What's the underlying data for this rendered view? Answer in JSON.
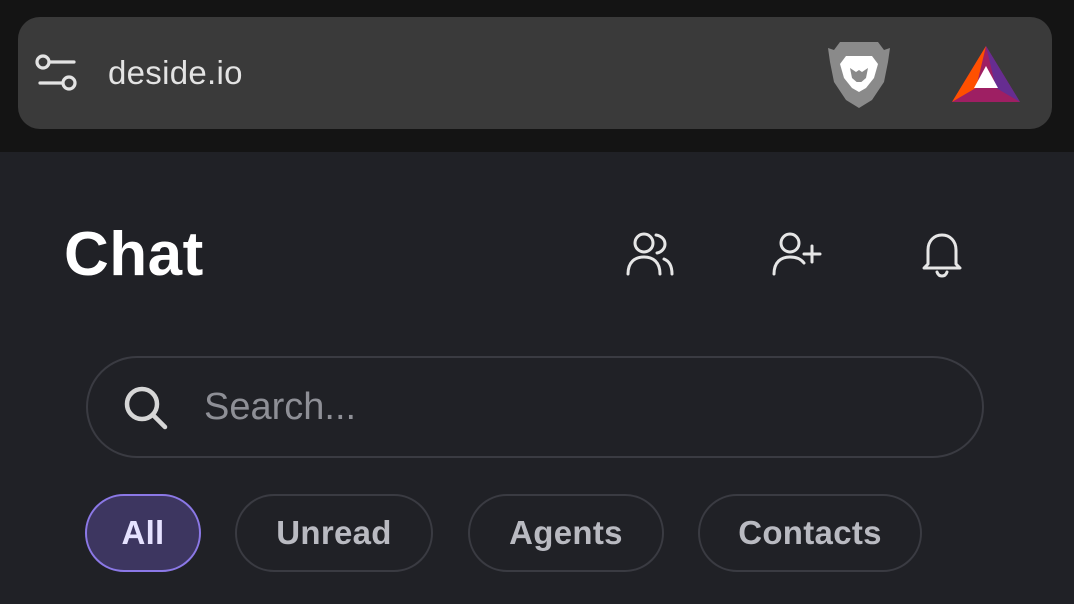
{
  "browser": {
    "url": "deside.io",
    "icons": {
      "site_settings": "site-settings-icon",
      "brave": "brave-lion-icon",
      "rewards": "brave-rewards-bat-icon"
    }
  },
  "header": {
    "title": "Chat",
    "icons": [
      "group-icon",
      "add-user-icon",
      "bell-icon"
    ]
  },
  "search": {
    "placeholder": "Search...",
    "value": "",
    "icon": "search-icon"
  },
  "filters": [
    {
      "label": "All",
      "active": true
    },
    {
      "label": "Unread",
      "active": false
    },
    {
      "label": "Agents",
      "active": false
    },
    {
      "label": "Contacts",
      "active": false
    }
  ],
  "colors": {
    "background": "#202126",
    "browser_bar": "#141414",
    "url_box": "#3a3a3a",
    "accent": "#8b78e6",
    "active_chip_bg": "#3d3660",
    "text": "#ffffff",
    "muted_text": "#b9bac1"
  }
}
